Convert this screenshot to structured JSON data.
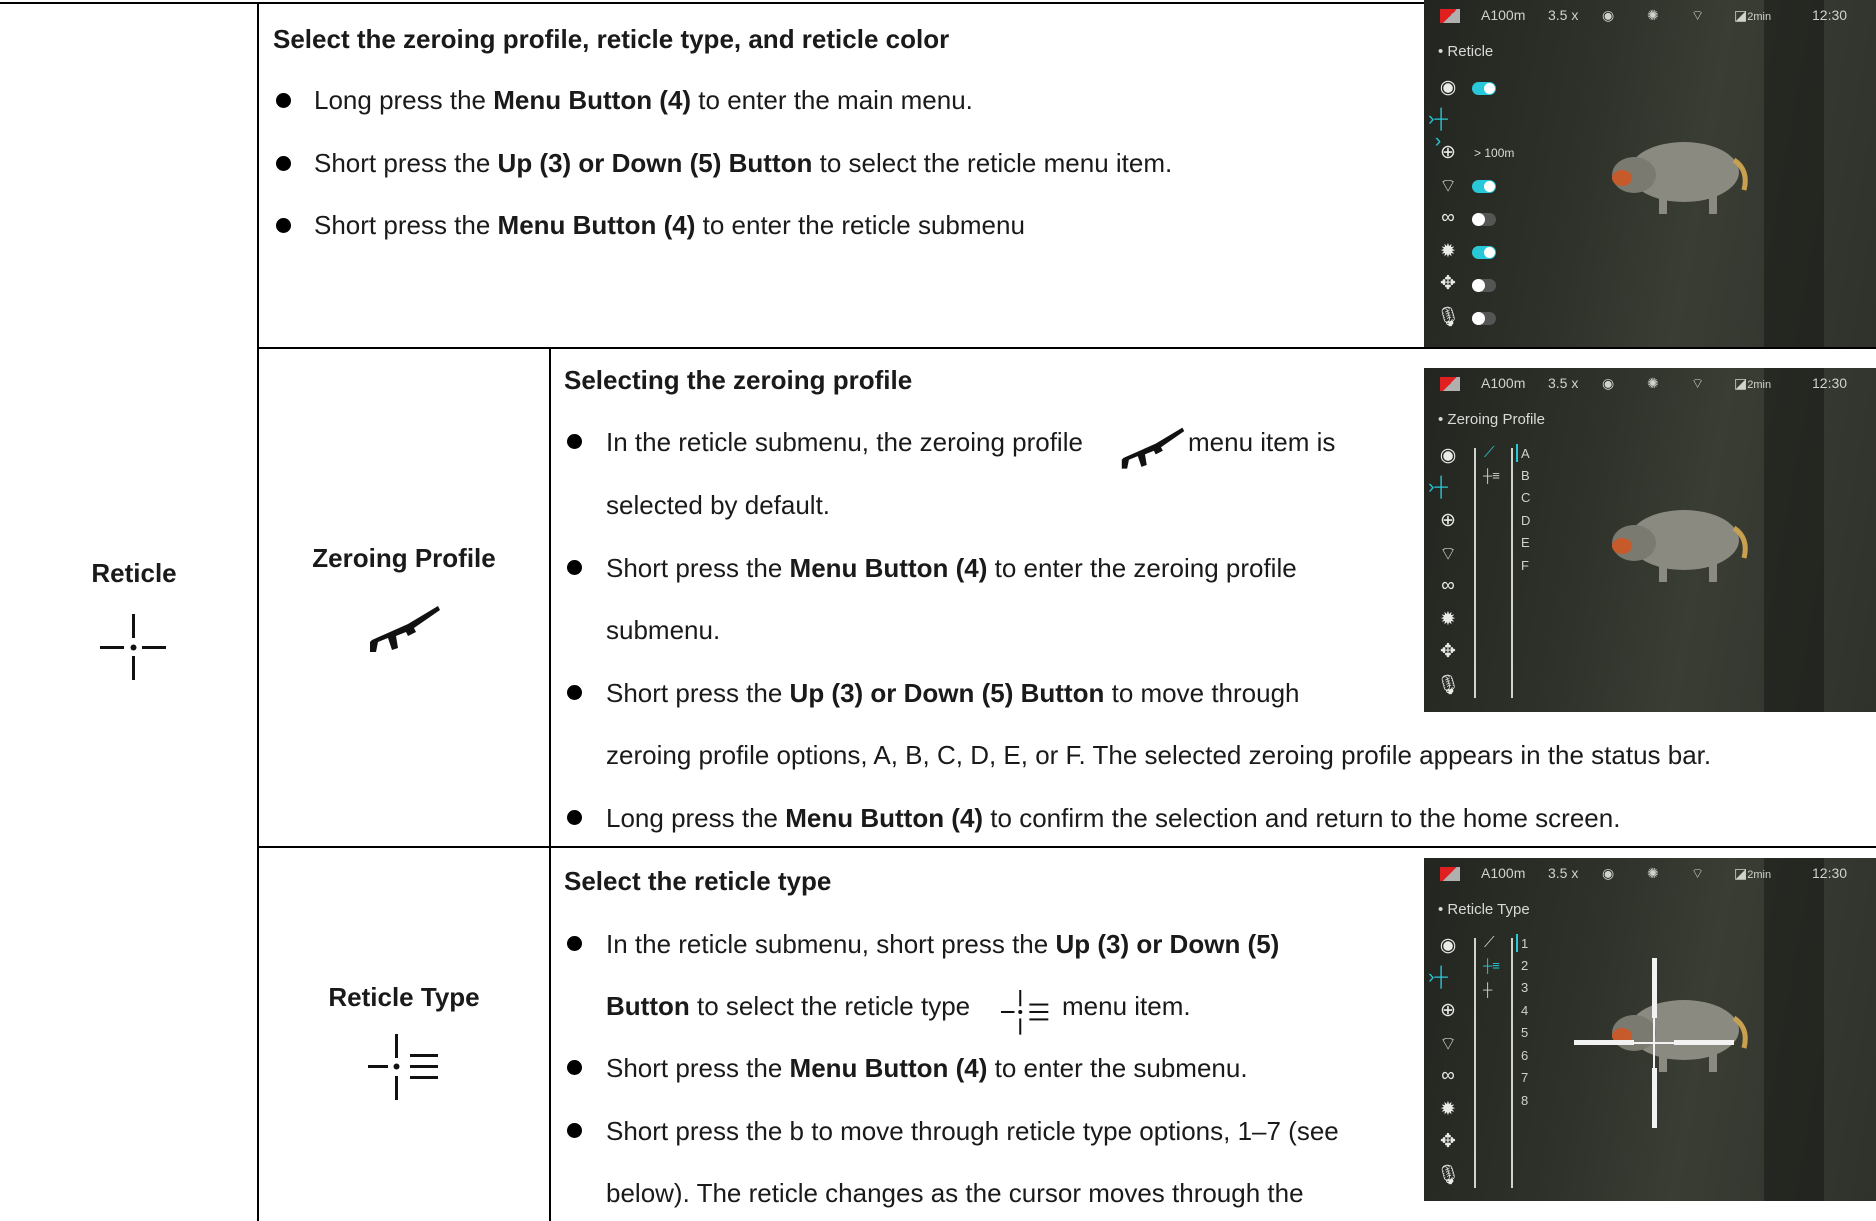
{
  "row_label": {
    "title": "Reticle"
  },
  "section1": {
    "title": "Select the zeroing profile, reticle type, and reticle color",
    "b1": {
      "pre": "Long press the ",
      "bold": "Menu Button (4)",
      "post": " to enter the main menu."
    },
    "b2": {
      "pre": "Short press the ",
      "bold": "Up (3) or Down (5) Button",
      "post": " to select the reticle menu item."
    },
    "b3": {
      "pre": "Short press the ",
      "bold": "Menu Button (4)",
      "post": " to enter the reticle submenu"
    }
  },
  "section2": {
    "label": "Zeroing Profile",
    "title": "Selecting the zeroing profile",
    "b1_pre": "In the reticle submenu, the zeroing profile",
    "b1_post": "menu item is",
    "b1_cont": "selected by default.",
    "b2": {
      "pre": "Short press the ",
      "bold": "Menu Button (4)",
      "post": " to enter the zeroing profile"
    },
    "b2_cont": "submenu.",
    "b3": {
      "pre": "Short press the ",
      "bold": "Up (3) or Down (5) Button",
      "post": " to move through"
    },
    "b3_cont": "zeroing profile options, A, B, C, D, E, or F. The selected zeroing profile appears in the status bar.",
    "b4": {
      "pre": "Long press the ",
      "bold": "Menu Button (4)",
      "post": " to confirm the selection and return to the home screen."
    }
  },
  "section3": {
    "label": "Reticle Type",
    "title": "Select the reticle type",
    "b1": {
      "pre": "In the reticle submenu, short press the ",
      "bold": "Up (3) or Down (5)"
    },
    "b1_cont": {
      "bold": "Button",
      "pre": " to select the reticle type",
      "post": "menu item."
    },
    "b2": {
      "pre": "Short press the ",
      "bold": "Menu Button (4)",
      "post": " to enter the submenu."
    },
    "b3": "Short press the b to move through reticle type options, 1–7 (see",
    "b3_cont": "below). The reticle changes as the cursor moves through the"
  },
  "screens": {
    "status": {
      "range": "A100m",
      "zoom": "3.5 x",
      "timer": "2min",
      "time": "12:30"
    },
    "screen1": {
      "menu_title": "• Reticle",
      "distance": "> 100m"
    },
    "screen2": {
      "menu_title": "• Zeroing Profile",
      "options": [
        "A",
        "B",
        "C",
        "D",
        "E",
        "F"
      ]
    },
    "screen3": {
      "menu_title": "• Reticle Type",
      "options": [
        "1",
        "2",
        "3",
        "4",
        "5",
        "6",
        "7",
        "8"
      ]
    }
  }
}
